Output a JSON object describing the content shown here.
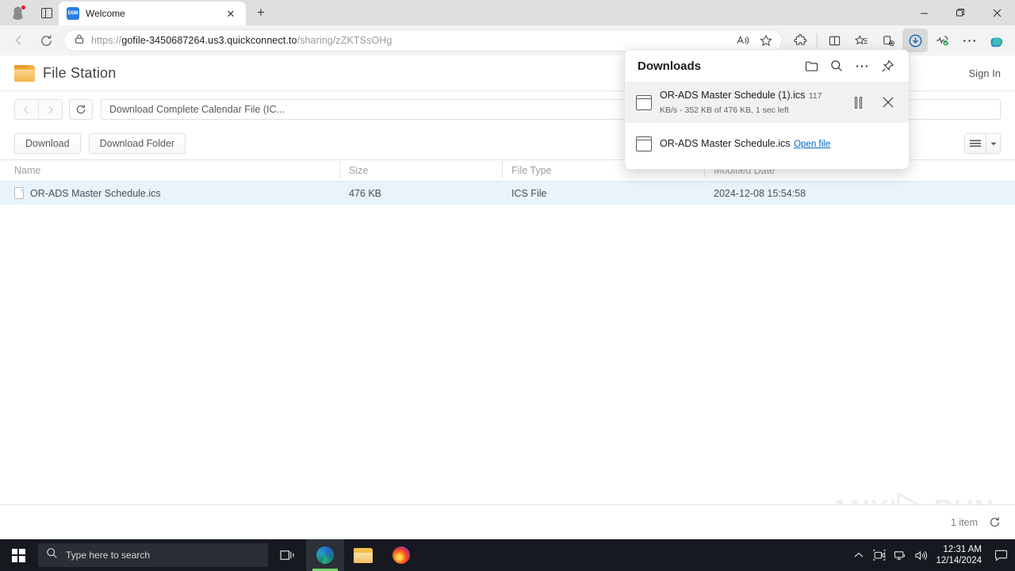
{
  "browser": {
    "tab": {
      "title": "Welcome",
      "favicon_label": "DSM",
      "favicon_name": "dsm-favicon",
      "close_glyph": "✕"
    },
    "new_tab_glyph": "+",
    "window_controls": {
      "minimize": "—",
      "maximize": "❐",
      "close": "✕"
    },
    "address": {
      "scheme": "https://",
      "domain": "gofile-3450687264.us3.quickconnect.to",
      "path": "/sharing/zZKTSsOHg",
      "full_url": "https://gofile-3450687264.us3.quickconnect.to/sharing/zZKTSsOHg"
    },
    "toolbar_icons": [
      "read-aloud-icon",
      "favorite-star-icon",
      "extensions-icon",
      "split-screen-icon",
      "favorites-icon",
      "collections-icon",
      "downloads-icon",
      "browser-essentials-icon",
      "settings-more-icon",
      "copilot-icon"
    ]
  },
  "downloads": {
    "title": "Downloads",
    "header_icons": [
      "open-folder-icon",
      "search-icon",
      "more-options-icon",
      "pin-icon"
    ],
    "items": [
      {
        "name": "OR-ADS Master Schedule (1).ics",
        "status": "117 KB/s - 352 KB of 476 KB, 1 sec left",
        "progress_percent": 74,
        "progress_color": "#0f6cbd",
        "actions": [
          "pause-download-button",
          "cancel-download-button"
        ]
      },
      {
        "name": "OR-ADS Master Schedule.ics",
        "link_label": "Open file",
        "link_color": "#0067c0"
      }
    ]
  },
  "file_station": {
    "app_title": "File Station",
    "sign_in_label": "Sign In",
    "breadcrumb": "Download Complete Calendar File (IC...",
    "search_value": "",
    "search_placeholder": "",
    "buttons": {
      "download": "Download",
      "download_folder": "Download Folder"
    },
    "columns": [
      "Name",
      "Size",
      "File Type",
      "Modified Date"
    ],
    "rows": [
      {
        "name": "OR-ADS Master Schedule.ics",
        "size": "476 KB",
        "file_type": "ICS File",
        "modified_date": "2024-12-08 15:54:58",
        "selected": true
      }
    ],
    "footer": {
      "item_count": "1 item",
      "refresh_icon": "refresh-icon"
    },
    "watermark": {
      "left": "ANY",
      "right": "RUN"
    }
  },
  "taskbar": {
    "search_placeholder": "Type here to search",
    "apps": [
      "task-view-icon",
      "microsoft-edge-icon",
      "file-explorer-icon",
      "firefox-icon"
    ],
    "tray_icons": [
      "show-hidden-icons-chevron",
      "screen-recording-icon",
      "network-icon",
      "volume-icon"
    ],
    "clock": {
      "time": "12:31 AM",
      "date": "12/14/2024"
    },
    "notification_icon": "action-center-icon"
  }
}
